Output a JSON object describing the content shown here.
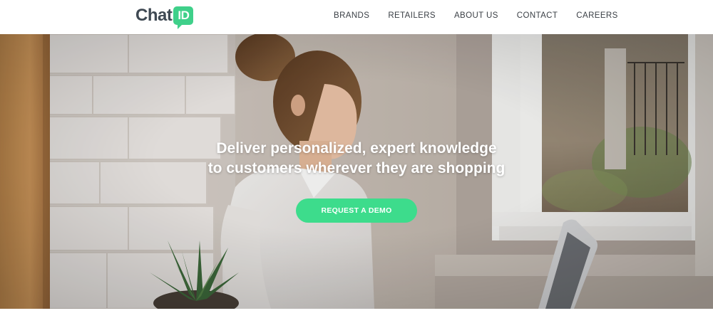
{
  "brand": {
    "logo_text": "Chat",
    "logo_badge": "ID",
    "accent_color": "#3fd08a"
  },
  "nav": {
    "items": [
      {
        "label": "BRANDS"
      },
      {
        "label": "RETAILERS"
      },
      {
        "label": "ABOUT US"
      },
      {
        "label": "CONTACT"
      },
      {
        "label": "CAREERS"
      }
    ]
  },
  "hero": {
    "headline_line1": "Deliver personalized, expert knowledge",
    "headline_line2": "to customers wherever they are shopping",
    "cta_label": "REQUEST A DEMO",
    "cta_color": "#3ddc8c"
  }
}
